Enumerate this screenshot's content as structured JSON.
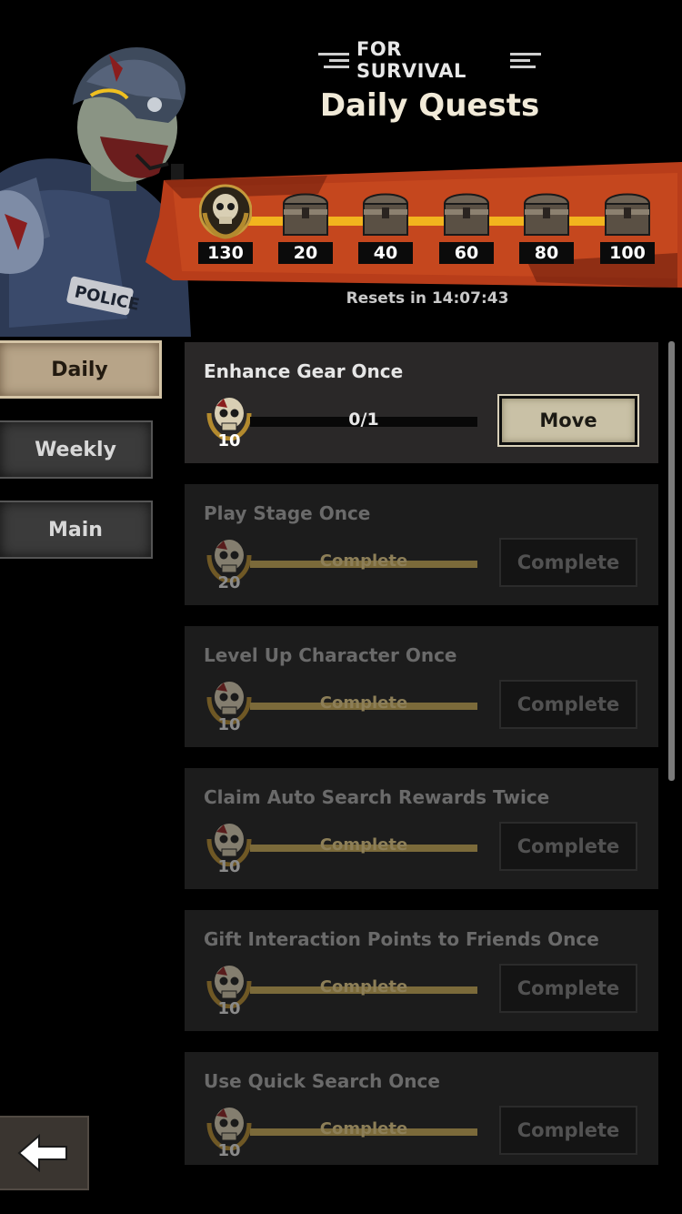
{
  "header": {
    "subtitle": "FOR SURVIVAL",
    "title": "Daily Quests"
  },
  "rewards": {
    "current_points": "130",
    "milestones": [
      "20",
      "40",
      "60",
      "80",
      "100"
    ],
    "reset_text": "Resets in 14:07:43"
  },
  "tabs": [
    {
      "label": "Daily",
      "active": true
    },
    {
      "label": "Weekly",
      "active": false
    },
    {
      "label": "Main",
      "active": false
    }
  ],
  "quests": [
    {
      "title": "Enhance Gear Once",
      "reward": "10",
      "progress": "0/1",
      "button": "Move",
      "state": "active"
    },
    {
      "title": "Play Stage Once",
      "reward": "20",
      "progress": "Complete",
      "button": "Complete",
      "state": "done"
    },
    {
      "title": "Level Up Character Once",
      "reward": "10",
      "progress": "Complete",
      "button": "Complete",
      "state": "done"
    },
    {
      "title": "Claim Auto Search Rewards Twice",
      "reward": "10",
      "progress": "Complete",
      "button": "Complete",
      "state": "done"
    },
    {
      "title": "Gift Interaction Points to Friends Once",
      "reward": "10",
      "progress": "Complete",
      "button": "Complete",
      "state": "done"
    },
    {
      "title": "Use Quick Search Once",
      "reward": "10",
      "progress": "Complete",
      "button": "Complete",
      "state": "done"
    }
  ],
  "icons": {
    "back": "back-arrow-icon",
    "reward": "skull-medal-icon",
    "milestone": "chest-icon"
  },
  "colors": {
    "banner": "#c4401a",
    "progress_line": "#f2b41e",
    "active_tab": "#b7a488"
  }
}
